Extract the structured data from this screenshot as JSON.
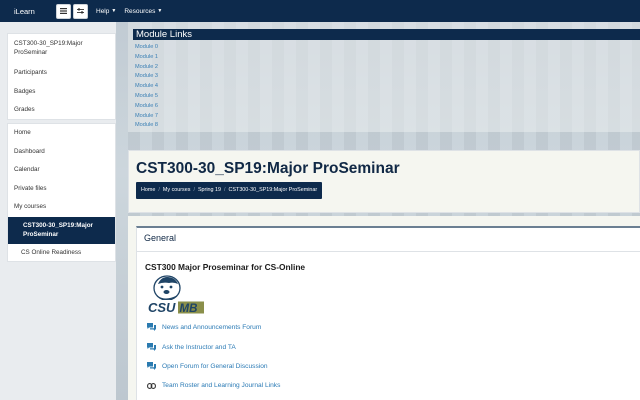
{
  "navbar": {
    "brand": "iLearn",
    "menu": [
      {
        "label": "Help"
      },
      {
        "label": "Resources"
      }
    ]
  },
  "sidebar": {
    "course_items": [
      {
        "label": "CST300-30_SP19:Major ProSeminar"
      },
      {
        "label": "Participants"
      },
      {
        "label": "Badges"
      },
      {
        "label": "Grades"
      }
    ],
    "nav_items": [
      {
        "label": "Home"
      },
      {
        "label": "Dashboard"
      },
      {
        "label": "Calendar"
      },
      {
        "label": "Private files"
      },
      {
        "label": "My courses"
      },
      {
        "label": "CST300-30_SP19:Major ProSeminar"
      },
      {
        "label": "CS Online Readiness"
      }
    ]
  },
  "modules": {
    "title": "Module Links",
    "links": [
      "Module 0",
      "Module 1",
      "Module 2",
      "Module 3",
      "Module 4",
      "Module 5",
      "Module 6",
      "Module 7",
      "Module 8"
    ]
  },
  "header": {
    "title": "CST300-30_SP19:Major ProSeminar",
    "breadcrumb": [
      "Home",
      "My courses",
      "Spring 19",
      "CST300-30_SP19:Major ProSeminar"
    ]
  },
  "section": {
    "name": "General",
    "heading": "CST300 Major Proseminar for CS-Online",
    "logo_text": "CSUMB",
    "activities": [
      {
        "label": "News and Announcements Forum",
        "icon": "forum-icon"
      },
      {
        "label": "Ask the Instructor and TA",
        "icon": "forum-icon"
      },
      {
        "label": "Open Forum for General Discussion",
        "icon": "forum-icon"
      },
      {
        "label": "Team Roster and Learning Journal Links",
        "icon": "link-icon"
      }
    ]
  },
  "colors": {
    "navbar": "#0d2a4c",
    "link": "#2a7ab5"
  }
}
